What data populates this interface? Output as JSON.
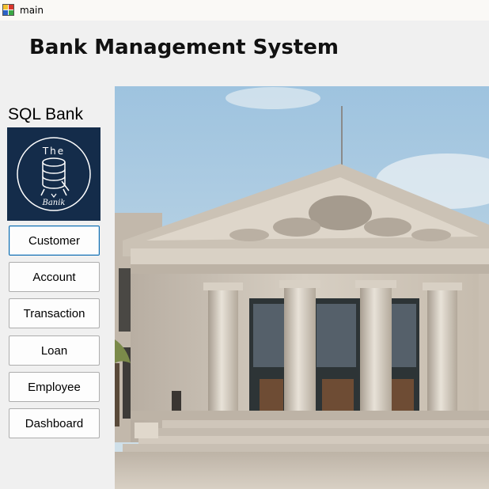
{
  "window": {
    "title": "main",
    "app_icon": "winforms-app-icon"
  },
  "header": {
    "title": "Bank Management System"
  },
  "sidebar": {
    "brand": "SQL Bank",
    "logo": {
      "icon": "database-logo-icon",
      "top_text": "The",
      "bottom_text": "Banik",
      "bg_color": "#142c4a"
    },
    "buttons": [
      {
        "label": "Customer",
        "active": true
      },
      {
        "label": "Account"
      },
      {
        "label": "Transaction"
      },
      {
        "label": "Loan"
      },
      {
        "label": "Employee"
      },
      {
        "label": "Dashboard"
      }
    ]
  },
  "main": {
    "image": "bank-building-photo"
  },
  "colors": {
    "window_bg": "#f0f0f0",
    "accent_border": "#0a6bb0"
  }
}
